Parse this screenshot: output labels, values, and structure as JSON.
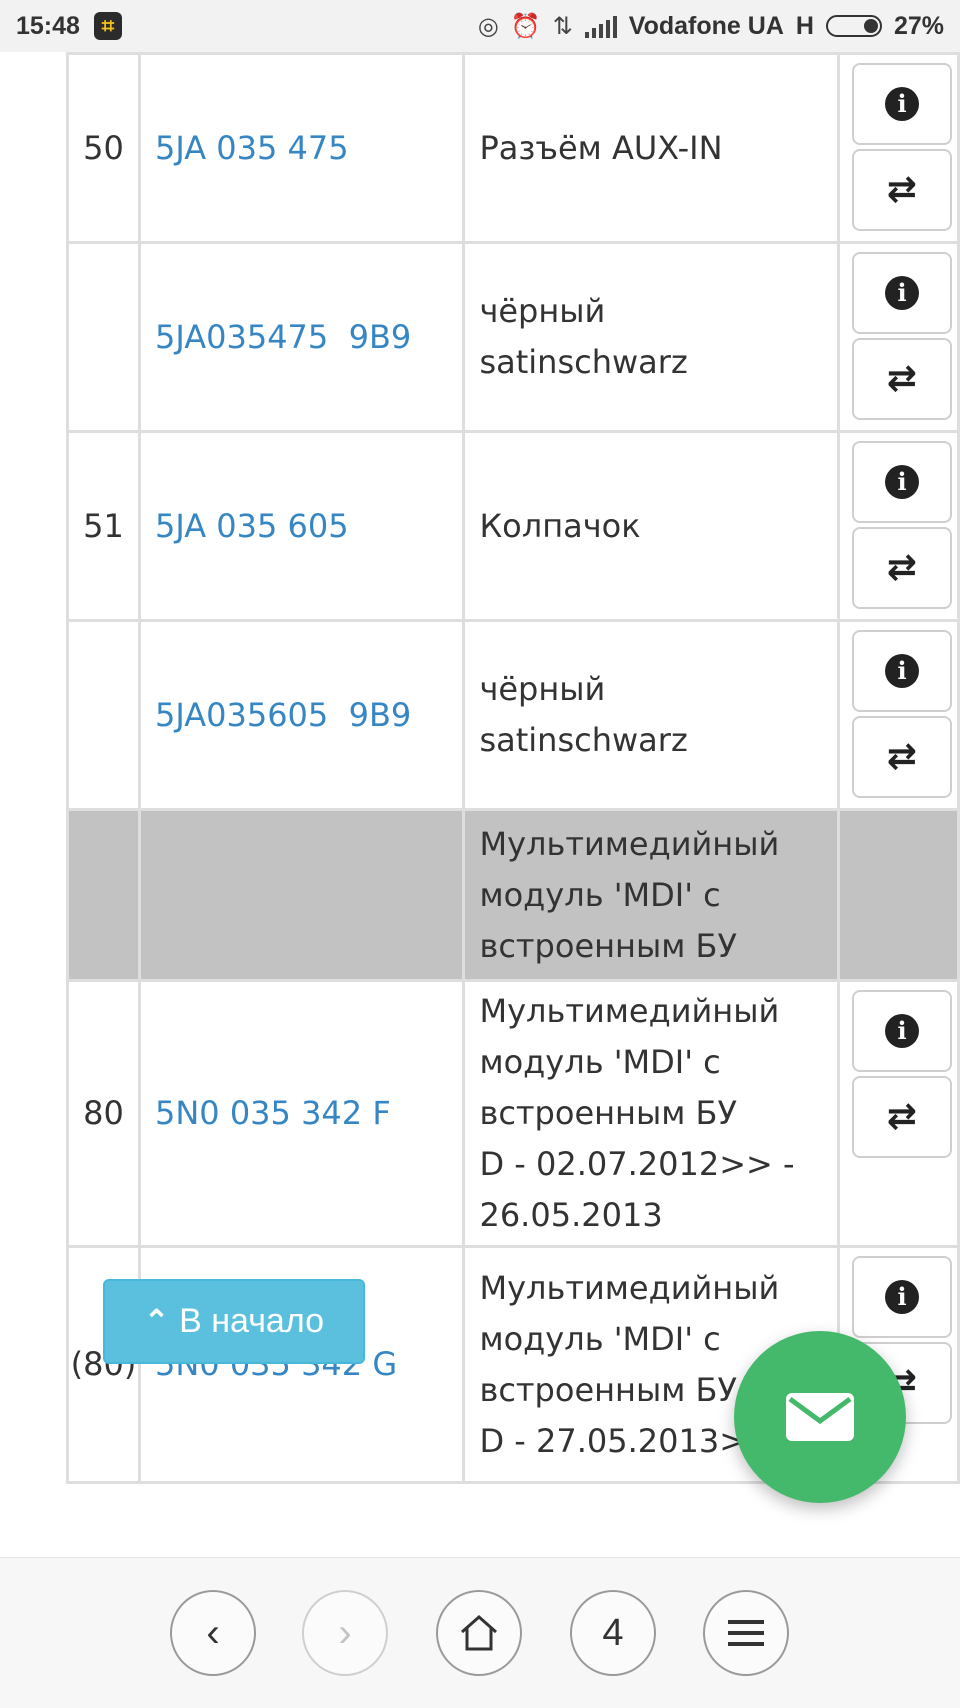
{
  "status_bar": {
    "time": "15:48",
    "carrier": "Vodafone UA",
    "network": "H",
    "battery": "27%",
    "icons": [
      "app-icon",
      "hotspot-icon",
      "alarm-icon",
      "data-arrows-icon",
      "signal-icon",
      "battery-icon"
    ]
  },
  "rows": [
    {
      "num": "50",
      "part": "5JA 035 475",
      "desc": [
        "Разъём AUX-IN"
      ],
      "actions": true
    },
    {
      "num": "",
      "part": "5JA035475  9B9",
      "desc": [
        "чёрный",
        "satinschwarz"
      ],
      "actions": true
    },
    {
      "num": "51",
      "part": "5JA 035 605",
      "desc": [
        "Колпачок"
      ],
      "actions": true
    },
    {
      "num": "",
      "part": "5JA035605  9B9",
      "desc": [
        "чёрный",
        "satinschwarz"
      ],
      "actions": true
    },
    {
      "num": "",
      "part": "",
      "desc": [
        "Мультимедийный",
        "модуль 'MDI' с",
        "встроенным БУ"
      ],
      "actions": false,
      "header": true
    },
    {
      "num": "80",
      "part": "5N0 035 342 F",
      "desc": [
        "Мультимедийный",
        "модуль 'MDI' с",
        "встроенным БУ",
        "D - 02.07.2012>> -",
        "26.05.2013"
      ],
      "actions": true
    },
    {
      "num": "(80)",
      "part": "5N0 035 342 G",
      "desc": [
        "Мультимедийный",
        "модуль 'MDI' с",
        "встроенным БУ",
        "D - 27.05.2013>>"
      ],
      "actions": true
    }
  ],
  "to_top_button": {
    "label": "В начало"
  },
  "bottom_nav": {
    "tab_count": "4"
  },
  "colors": {
    "link": "#3786c4",
    "grey_row": "#c2c2c2",
    "to_top": "#5bc0de",
    "fab": "#44b96b"
  }
}
